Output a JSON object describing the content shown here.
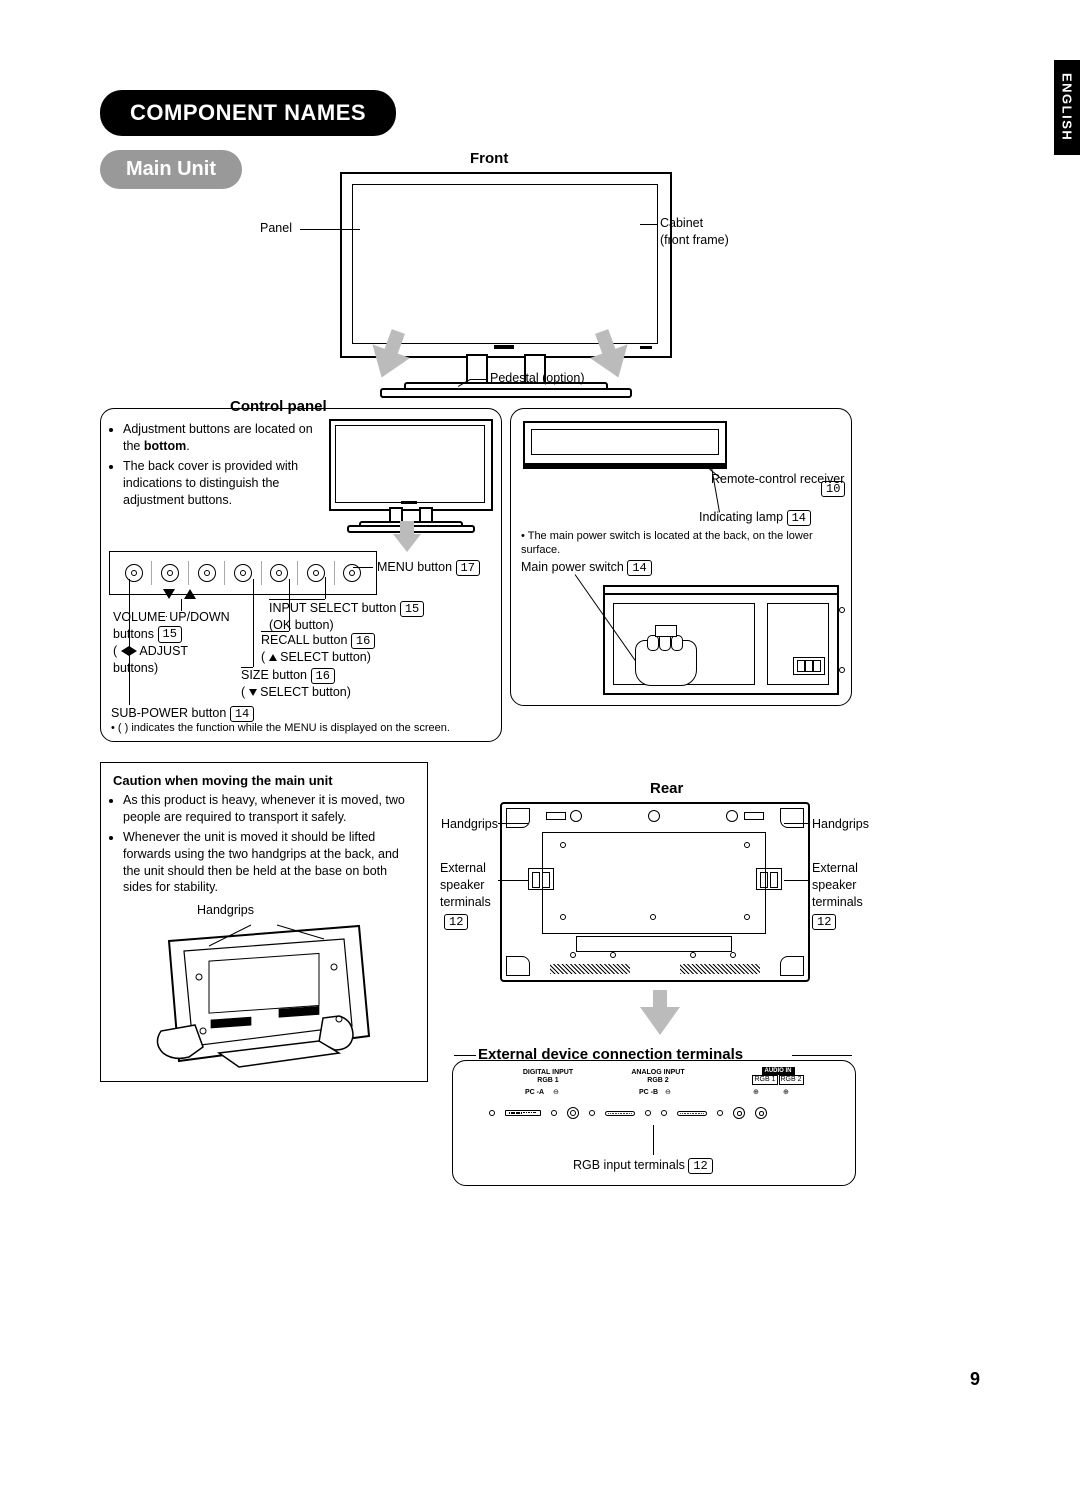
{
  "page_number": "9",
  "language_tab": "ENGLISH",
  "title": "COMPONENT NAMES",
  "sections": {
    "main_unit": "Main Unit",
    "front": "Front",
    "control_panel": "Control panel",
    "rear": "Rear",
    "ext_terminals": "External device connection terminals"
  },
  "front_diagram": {
    "panel": "Panel",
    "cabinet": "Cabinet",
    "cabinet_sub": "(front frame)",
    "pedestal": "Pedestal (option)"
  },
  "control_panel_notes": [
    "Adjustment buttons are located on the ",
    "bottom",
    ".",
    "The back cover is provided with indications to distinguish the adjustment buttons."
  ],
  "control_panel_labels": {
    "menu": "MENU button",
    "menu_ref": "17",
    "input_select": "INPUT SELECT button",
    "input_select_sub": "(OK button)",
    "input_select_ref": "15",
    "recall": "RECALL button",
    "recall_sub_up": "( ▲ SELECT button)",
    "recall_ref": "16",
    "size": "SIZE button",
    "size_sub_down": "( ▼ SELECT button)",
    "size_ref": "16",
    "volume": "VOLUME UP/DOWN buttons",
    "volume_ref": "15",
    "adjust": "( ◀ ▶ ADJUST buttons)",
    "subpower": "SUB-POWER button",
    "subpower_ref": "14",
    "paren_note": "( ) indicates the function while the MENU is displayed on the screen."
  },
  "right_panel": {
    "remote_receiver": "Remote-control receiver",
    "remote_receiver_ref": "10",
    "indicating_lamp": "Indicating lamp",
    "indicating_lamp_ref": "14",
    "main_power_note": "The main power switch is located at the back, on the lower surface.",
    "main_power_switch": "Main power switch",
    "main_power_switch_ref": "14"
  },
  "caution": {
    "title": "Caution when moving the main unit",
    "items": [
      "As this product is heavy, whenever it is moved, two people are required to transport it safely.",
      "Whenever the unit is moved it should be lifted forwards using the two handgrips at the back, and the unit should then be held at the base on both sides for stability."
    ],
    "handgrips": "Handgrips"
  },
  "rear": {
    "handgrips_left": "Handgrips",
    "handgrips_right": "Handgrips",
    "ext_spk_left": "External speaker terminals",
    "ext_spk_right": "External speaker terminals",
    "ext_spk_ref_left": "12",
    "ext_spk_ref_right": "12"
  },
  "terminals": {
    "rgb_input": "RGB input terminals",
    "rgb_input_ref": "12",
    "digital_input": "DIGITAL INPUT",
    "rgb1": "RGB 1",
    "analog_input": "ANALOG INPUT",
    "rgb2": "RGB 2",
    "audio_in": "AUDIO IN",
    "audio_rgb1": "RGB 1",
    "audio_rgb2": "RGB 2",
    "pc_a": "PC -A",
    "pc_b": "PC -B"
  }
}
